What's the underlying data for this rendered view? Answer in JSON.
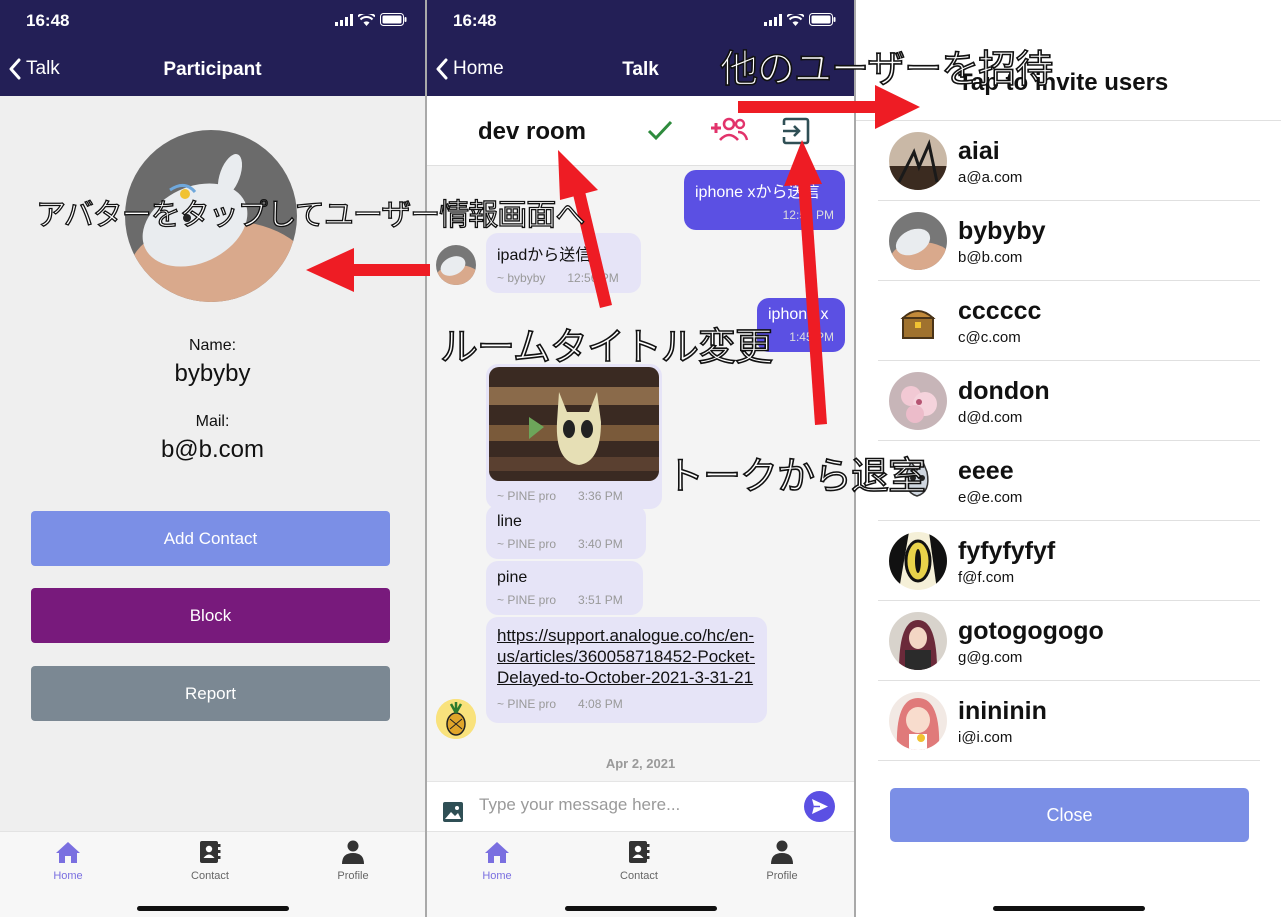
{
  "status": {
    "time": "16:48"
  },
  "colors": {
    "navbar": "#231f56",
    "accent": "#5b50e3",
    "incoming": "#e6e4f7",
    "add_contact": "#7b8fe6",
    "block": "#781a7c",
    "report": "#7b8893",
    "check": "#2e8b3d",
    "invite_icon": "#e2336b"
  },
  "participant": {
    "back_label": "Talk",
    "title": "Participant",
    "name_label": "Name:",
    "name_value": "bybyby",
    "mail_label": "Mail:",
    "mail_value": "b@b.com",
    "add_contact": "Add Contact",
    "block": "Block",
    "report": "Report"
  },
  "talk": {
    "back_label": "Home",
    "title": "Talk",
    "room_title": "dev room",
    "messages": [
      {
        "dir": "out",
        "text": "iphone xから送信",
        "time": "12:55 PM"
      },
      {
        "dir": "in",
        "text": "ipadから送信",
        "sender": "~ bybyby",
        "time": "12:56 PM"
      },
      {
        "dir": "out",
        "text": "iphone x",
        "time": "1:45 PM"
      },
      {
        "dir": "in",
        "sender": "~ PINE pro",
        "time": "3:36 PM"
      },
      {
        "dir": "in",
        "text": "line",
        "sender": "~ PINE pro",
        "time": "3:40 PM"
      },
      {
        "dir": "in",
        "text": "pine",
        "sender": "~ PINE pro",
        "time": "3:51 PM"
      },
      {
        "dir": "in",
        "link": "https://support.analogue.co/hc/en-us/articles/360058718452-Pocket-Delayed-to-October-2021-3-31-21",
        "sender": "~ PINE pro",
        "time": "4:08 PM"
      }
    ],
    "date_separator": "Apr 2, 2021",
    "input_placeholder": "Type your message here..."
  },
  "tabs": [
    {
      "label": "Home",
      "icon": "home-icon"
    },
    {
      "label": "Contact",
      "icon": "contact-book-icon"
    },
    {
      "label": "Profile",
      "icon": "person-icon"
    }
  ],
  "invite": {
    "title": "Tap to invite users",
    "users": [
      {
        "name": "aiai",
        "email": "a@a.com"
      },
      {
        "name": "bybyby",
        "email": "b@b.com"
      },
      {
        "name": "cccccc",
        "email": "c@c.com"
      },
      {
        "name": "dondon",
        "email": "d@d.com"
      },
      {
        "name": "eeee",
        "email": "e@e.com"
      },
      {
        "name": "fyfyfyfyf",
        "email": "f@f.com"
      },
      {
        "name": "gotogogogo",
        "email": "g@g.com"
      },
      {
        "name": "inininin",
        "email": "i@i.com"
      }
    ],
    "close": "Close"
  },
  "annotations": {
    "avatar_tap": "アバターをタップしてユーザー情報画面へ",
    "room_title_change": "ルームタイトル変更",
    "leave_talk": "トークから退室",
    "invite_users": "他のユーザーを招待"
  }
}
